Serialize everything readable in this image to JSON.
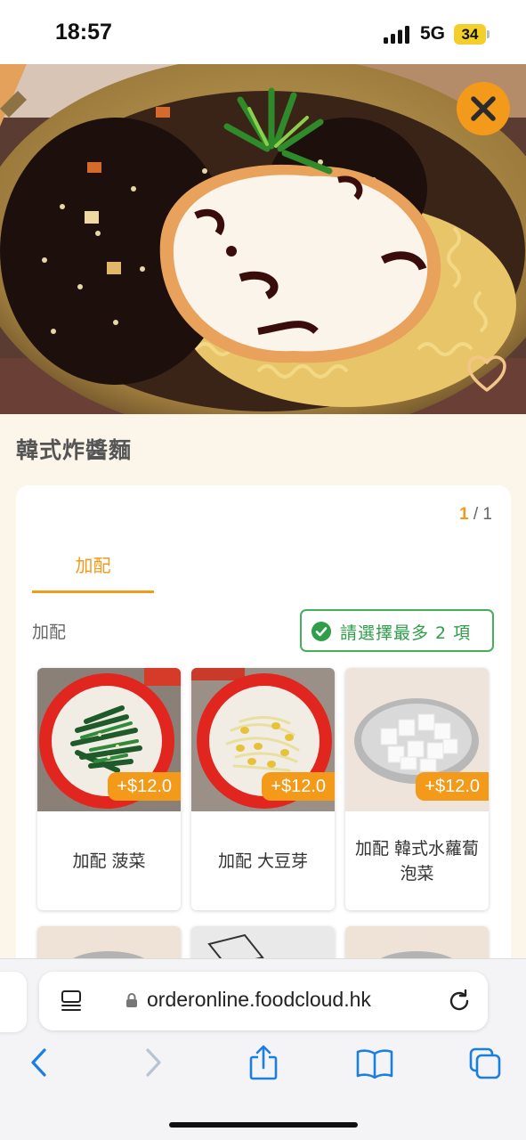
{
  "status_bar": {
    "time": "18:57",
    "network": "5G",
    "battery": "34"
  },
  "dish": {
    "title": "韓式炸醬麵"
  },
  "card": {
    "pager_current": "1",
    "pager_separator": " / ",
    "pager_total": "1",
    "tab_label": "加配",
    "group_label": "加配",
    "rule_text": "請選擇最多 2 項"
  },
  "options": [
    {
      "price": "+$12.0",
      "name": "加配 菠菜",
      "photo": "spinach-icon"
    },
    {
      "price": "+$12.0",
      "name": "加配 大豆芽",
      "photo": "soybean-sprouts-icon"
    },
    {
      "price": "+$12.0",
      "name": "加配 韓式水蘿蔔泡菜",
      "photo": "radish-kimchi-icon"
    }
  ],
  "browser": {
    "url": "orderonline.foodcloud.hk"
  },
  "colors": {
    "accent": "#f39a1a",
    "success": "#2e9e48",
    "background": "#fbf5ea",
    "browser_blue": "#1a7fe0"
  }
}
